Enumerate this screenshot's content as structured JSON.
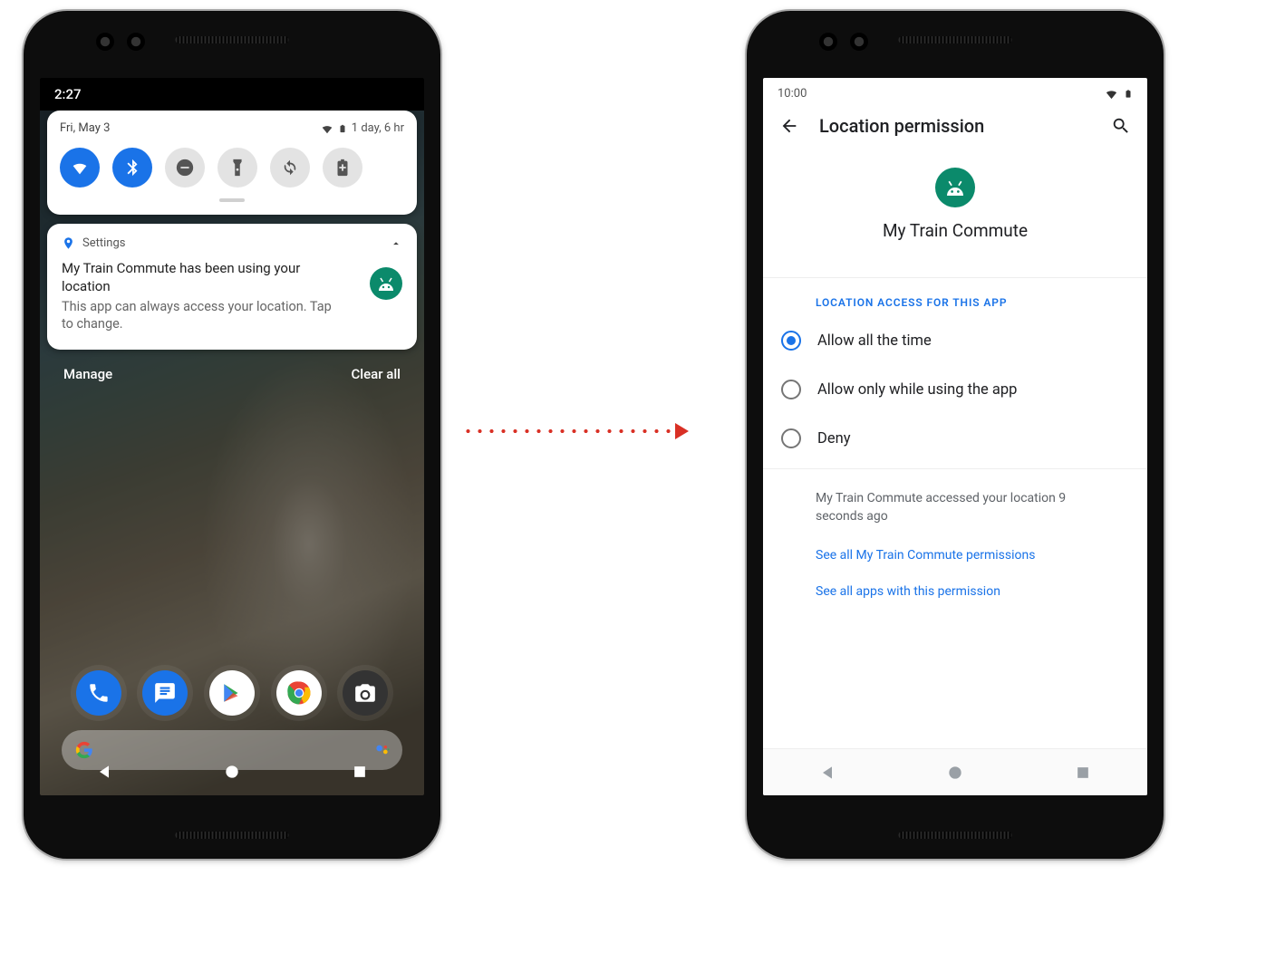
{
  "left": {
    "status": {
      "time": "2:27"
    },
    "qs": {
      "date": "Fri, May 3",
      "battery_info": "1 day, 6 hr",
      "tiles": [
        "wifi",
        "bluetooth",
        "dnd",
        "flashlight",
        "rotate",
        "battery"
      ]
    },
    "notif": {
      "source": "Settings",
      "title": "My Train Commute has been using your location",
      "body": "This app can always access your location. Tap to change.",
      "app_icon": "android"
    },
    "actions": {
      "manage": "Manage",
      "clear": "Clear all"
    },
    "dock": [
      "phone",
      "messages",
      "play",
      "chrome",
      "camera"
    ]
  },
  "right": {
    "status": {
      "time": "10:00"
    },
    "appbar": {
      "title": "Location permission"
    },
    "app": {
      "name": "My Train Commute",
      "icon": "android"
    },
    "section": "LOCATION ACCESS FOR THIS APP",
    "options": [
      {
        "label": "Allow all the time",
        "selected": true
      },
      {
        "label": "Allow only while using the app",
        "selected": false
      },
      {
        "label": "Deny",
        "selected": false
      }
    ],
    "note": "My Train Commute accessed your location 9 seconds ago",
    "links": [
      "See all My Train Commute permissions",
      "See all apps with this permission"
    ]
  }
}
